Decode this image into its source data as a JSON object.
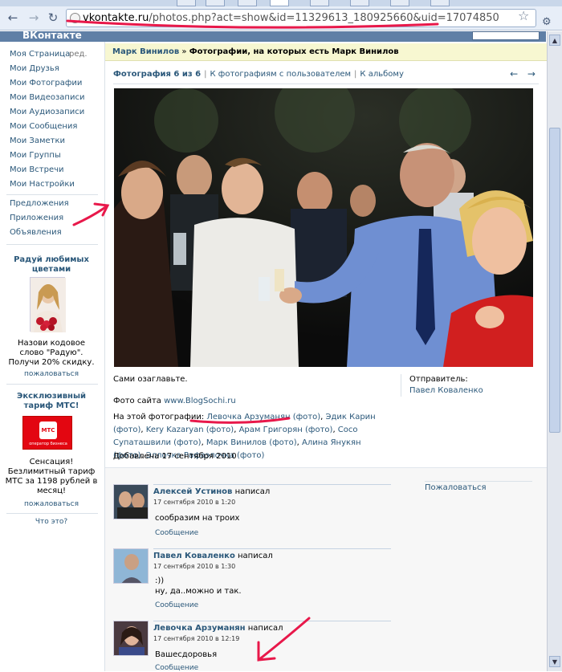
{
  "browser": {
    "url_host": "vkontakte.ru",
    "url_path": "/photos.php?act=show&id=11329613_180925660&uid=17074850",
    "brand": "ВКонтакте"
  },
  "sidebar": {
    "items": [
      {
        "label": "Моя Страница"
      },
      {
        "label": "Мои Друзья"
      },
      {
        "label": "Мои Фотографии"
      },
      {
        "label": "Мои Видеозаписи"
      },
      {
        "label": "Мои Аудиозаписи"
      },
      {
        "label": "Мои Сообщения"
      },
      {
        "label": "Мои Заметки"
      },
      {
        "label": "Мои Группы"
      },
      {
        "label": "Мои Встречи"
      },
      {
        "label": "Мои Настройки"
      }
    ],
    "edit_label": "ред.",
    "extra": [
      {
        "label": "Предложения"
      },
      {
        "label": "Приложения"
      },
      {
        "label": "Объявления"
      }
    ],
    "ad1": {
      "title": "Радуй любимых цветами",
      "text": "Назови кодовое слово \"Радую\". Получи 20% скидку.",
      "report": "пожаловаться"
    },
    "ad2": {
      "title": "Эксклюзивный тариф МТС!",
      "logo_text": "МТС",
      "logo_sub": "оператор бизнеса",
      "text": "Сенсация! Безлимитный тариф МТС за 1198 рублей в месяц!",
      "report": "пожаловаться"
    },
    "what_is": "Что это?"
  },
  "main": {
    "breadcrumb_user": "Марк Винилов",
    "breadcrumb_sep": " » ",
    "breadcrumb_title": "Фотографии, на которых есть Марк Винилов",
    "photo_counter": "Фотография 6 из 6",
    "link_with_user": "К фотографиям с пользователем",
    "link_album": "К альбому",
    "nav_arrows": "← →",
    "caption": "Сами озаглавьте.",
    "source_prefix": "Фото сайта ",
    "source_link": "www.BlogSochi.ru",
    "on_photo_label": "На этой фотографии: ",
    "people": [
      {
        "name": "Левочка Арзуманян",
        "tag": "(фото)"
      },
      {
        "name": "Эдик Карин",
        "tag": "(фото)"
      },
      {
        "name": "Kery Kazaryan",
        "tag": "(фото)"
      },
      {
        "name": "Арам Григорян",
        "tag": "(фото)"
      },
      {
        "name": "Сосо Супаташвили",
        "tag": "(фото)"
      },
      {
        "name": "Марк Винилов",
        "tag": "(фото)"
      },
      {
        "name": "Алина Янукян",
        "tag": "(фото)"
      },
      {
        "name": "Эллочка Рафаэлочка",
        "tag": "(фото)"
      }
    ],
    "added": "Добавлена 17 сентября 2010",
    "sender_label": "Отправитель:",
    "sender_name": "Павел Коваленко",
    "complain": "Пожаловаться"
  },
  "comments": [
    {
      "author": "Алексей Устинов",
      "verb": "написал",
      "date": "17 сентября 2010 в 1:20",
      "lines": [
        "сообразим на троих"
      ],
      "reply": "Сообщение"
    },
    {
      "author": "Павел Коваленко",
      "verb": "написал",
      "date": "17 сентября 2010 в 1:30",
      "lines": [
        ":))",
        "ну, да..можно и так."
      ],
      "reply": "Сообщение"
    },
    {
      "author": "Левочка Арзуманян",
      "verb": "написал",
      "date": "17 сентября 2010 в 12:19",
      "lines": [
        "Вашесдоровья"
      ],
      "reply": "Сообщение"
    }
  ],
  "colors": {
    "link": "#2b587a",
    "header": "#5f7fa6",
    "annotation": "#e8184a"
  }
}
